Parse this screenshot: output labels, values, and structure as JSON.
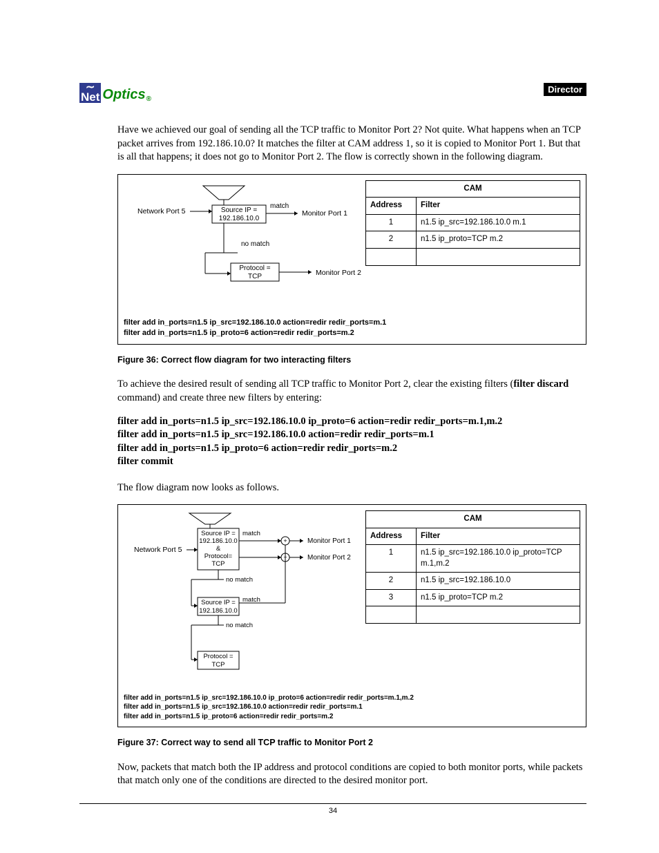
{
  "header": {
    "logo_net": "Net",
    "logo_optics": "Optics",
    "logo_r": "®",
    "doc_tag": "Director"
  },
  "para1": "Have we achieved our goal of sending all the TCP traffic to Monitor Port 2? Not quite. What happens when an TCP packet arrives from 192.186.10.0? It matches the filter at CAM address 1, so it is copied to Monitor Port 1. But that is all that happens; it does not go to Monitor Port 2. The flow is correctly shown in the following diagram.",
  "fig36": {
    "caption": "Figure 36: Correct flow diagram for two interacting filters",
    "diag": {
      "net_port": "Network Port 5",
      "box1_l1": "Source IP =",
      "box1_l2": "192.186.10.0",
      "match": "match",
      "no_match": "no match",
      "mon1": "Monitor Port 1",
      "box2_l1": "Protocol =",
      "box2_l2": "TCP",
      "mon2": "Monitor Port 2"
    },
    "cam": {
      "title": "CAM",
      "h1": "Address",
      "h2": "Filter",
      "rows": [
        {
          "addr": "1",
          "filter": "n1.5 ip_src=192.186.10.0 m.1"
        },
        {
          "addr": "2",
          "filter": "n1.5 ip_proto=TCP m.2"
        }
      ]
    },
    "cmds": [
      "filter add in_ports=n1.5 ip_src=192.186.10.0 action=redir redir_ports=m.1",
      "filter add in_ports=n1.5 ip_proto=6 action=redir redir_ports=m.2"
    ]
  },
  "para2a": "To achieve the desired result of sending all TCP traffic to Monitor Port 2, clear the existing filters (",
  "para2b": "filter discard",
  "para2c": " command) and create three new filters by entering:",
  "commands": [
    "filter add in_ports=n1.5 ip_src=192.186.10.0 ip_proto=6  action=redir redir_ports=m.1,m.2",
    "filter add in_ports=n1.5 ip_src=192.186.10.0 action=redir redir_ports=m.1",
    "filter add in_ports=n1.5 ip_proto=6 action=redir redir_ports=m.2",
    "filter commit"
  ],
  "para3": "The flow diagram now looks as follows.",
  "fig37": {
    "caption": "Figure 37: Correct way to send all TCP traffic to Monitor Port 2",
    "diag": {
      "net_port": "Network Port 5",
      "box1_l1": "Source IP =",
      "box1_l2": "192.186.10.0",
      "box1_amp": "&",
      "box1_l3": "Protocol=",
      "box1_l4": "TCP",
      "match": "match",
      "no_match": "no match",
      "mon1": "Monitor Port 1",
      "mon2": "Monitor Port 2",
      "box2_l1": "Source IP =",
      "box2_l2": "192.186.10.0",
      "box3_l1": "Protocol =",
      "box3_l2": "TCP"
    },
    "cam": {
      "title": "CAM",
      "h1": "Address",
      "h2": "Filter",
      "rows": [
        {
          "addr": "1",
          "filter": "n1.5 ip_src=192.186.10.0 ip_proto=TCP m.1,m.2"
        },
        {
          "addr": "2",
          "filter": "n1.5 ip_src=192.186.10.0"
        },
        {
          "addr": "3",
          "filter": "n1.5 ip_proto=TCP m.2"
        }
      ]
    },
    "cmds": [
      "filter add in_ports=n1.5 ip_src=192.186.10.0 ip_proto=6  action=redir redir_ports=m.1,m.2",
      "filter add in_ports=n1.5 ip_src=192.186.10.0 action=redir redir_ports=m.1",
      "filter add in_ports=n1.5 ip_proto=6 action=redir redir_ports=m.2"
    ]
  },
  "para4": "Now, packets that match both the IP address and protocol conditions are copied to both monitor ports, while packets that match only one of the conditions are directed to the desired monitor port.",
  "page_num": "34"
}
